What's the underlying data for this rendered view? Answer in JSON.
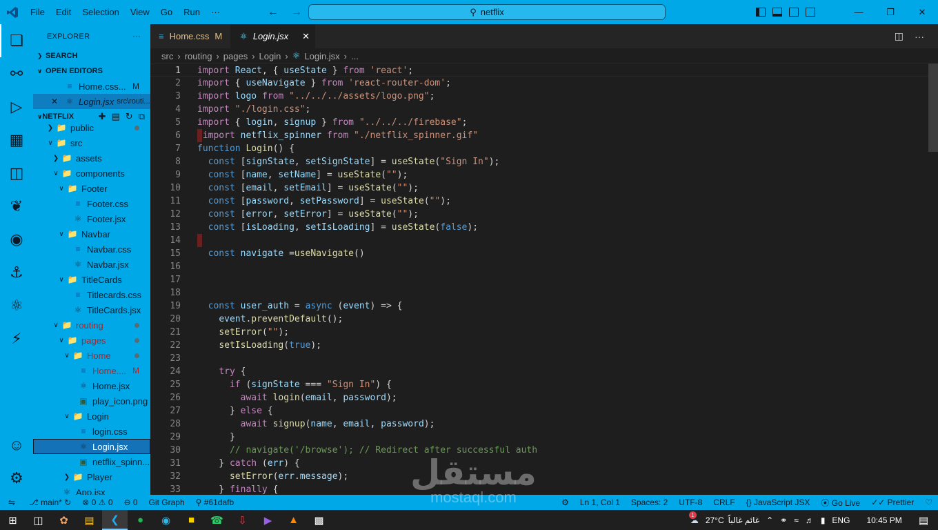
{
  "titlebar": {
    "menu": [
      "File",
      "Edit",
      "Selection",
      "View",
      "Go",
      "Run",
      "···"
    ],
    "search": "netflix"
  },
  "sidebar": {
    "title": "EXPLORER",
    "search_section": "SEARCH",
    "open_editors_section": "OPEN EDITORS",
    "open_editors": [
      {
        "name": "Home.css...",
        "badge": "M"
      },
      {
        "name": "Login.jsx",
        "path": "src\\routi..."
      }
    ],
    "project": "NETFLIX",
    "tree": [
      {
        "name": "public",
        "depth": 0,
        "type": "folder"
      },
      {
        "name": "src",
        "depth": 0,
        "type": "folder"
      },
      {
        "name": "assets",
        "depth": 1,
        "type": "folder"
      },
      {
        "name": "components",
        "depth": 1,
        "type": "folder"
      },
      {
        "name": "Footer",
        "depth": 2,
        "type": "folder"
      },
      {
        "name": "Footer.css",
        "depth": 3,
        "type": "css"
      },
      {
        "name": "Footer.jsx",
        "depth": 3,
        "type": "jsx"
      },
      {
        "name": "Navbar",
        "depth": 2,
        "type": "folder"
      },
      {
        "name": "Navbar.css",
        "depth": 3,
        "type": "css"
      },
      {
        "name": "Navbar.jsx",
        "depth": 3,
        "type": "jsx"
      },
      {
        "name": "TitleCards",
        "depth": 2,
        "type": "folder"
      },
      {
        "name": "Titlecards.css",
        "depth": 3,
        "type": "css"
      },
      {
        "name": "TitleCards.jsx",
        "depth": 3,
        "type": "jsx"
      },
      {
        "name": "routing",
        "depth": 1,
        "type": "folder"
      },
      {
        "name": "pages",
        "depth": 2,
        "type": "folder"
      },
      {
        "name": "Home",
        "depth": 3,
        "type": "folder"
      },
      {
        "name": "Home....",
        "depth": 4,
        "type": "css",
        "badge": "M"
      },
      {
        "name": "Home.jsx",
        "depth": 4,
        "type": "jsx"
      },
      {
        "name": "play_icon.png",
        "depth": 4,
        "type": "img"
      },
      {
        "name": "Login",
        "depth": 3,
        "type": "folder"
      },
      {
        "name": "login.css",
        "depth": 4,
        "type": "css"
      },
      {
        "name": "Login.jsx",
        "depth": 4,
        "type": "jsx"
      },
      {
        "name": "netflix_spinn...",
        "depth": 4,
        "type": "img"
      },
      {
        "name": "Player",
        "depth": 3,
        "type": "folder"
      },
      {
        "name": "App.jsx",
        "depth": 1,
        "type": "jsx"
      }
    ]
  },
  "tabs": [
    {
      "name": "Home.css",
      "badge": "M"
    },
    {
      "name": "Login.jsx"
    }
  ],
  "breadcrumb": [
    "src",
    "routing",
    "pages",
    "Login",
    "Login.jsx",
    "..."
  ],
  "code_lines": [
    "import React, { useState } from 'react';",
    "import { useNavigate } from 'react-router-dom';",
    "import logo from \"../../../assets/logo.png\";",
    "import \"./login.css\";",
    "import { login, signup } from \"../../../firebase\";",
    " import netflix_spinner from \"./netflix_spinner.gif\"",
    "function Login() {",
    "  const [signState, setSignState] = useState(\"Sign In\");",
    "  const [name, setName] = useState(\"\");",
    "  const [email, setEmail] = useState(\"\");",
    "  const [password, setPassword] = useState(\"\");",
    "  const [error, setError] = useState(\"\");",
    "  const [isLoading, setIsLoading] = useState(false);",
    "",
    "  const navigate =useNavigate()",
    "",
    "",
    "",
    "  const user_auth = async (event) => {",
    "    event.preventDefault();",
    "    setError(\"\");",
    "    setIsLoading(true);",
    "",
    "    try {",
    "      if (signState === \"Sign In\") {",
    "        await login(email, password);",
    "      } else {",
    "        await signup(name, email, password);",
    "      }",
    "      // navigate('/browse'); // Redirect after successful auth",
    "    } catch (err) {",
    "      setError(err.message);",
    "    } finally {"
  ],
  "statusbar": {
    "branch": "main*",
    "errors": "0",
    "warnings": "0",
    "info": "0",
    "git_graph": "Git Graph",
    "commit": "#61dafb",
    "position": "Ln 1, Col 1",
    "spaces": "Spaces: 2",
    "encoding": "UTF-8",
    "eol": "CRLF",
    "language": "JavaScript JSX",
    "golive": "Go Live",
    "prettier": "Prettier"
  },
  "taskbar": {
    "weather_temp": "27°C",
    "weather_text": "غائم غالباً",
    "weather_badge": "1",
    "lang": "ENG",
    "time": "10:45 PM"
  },
  "watermark": {
    "arabic": "مستقل",
    "latin": "mostaql.com"
  }
}
